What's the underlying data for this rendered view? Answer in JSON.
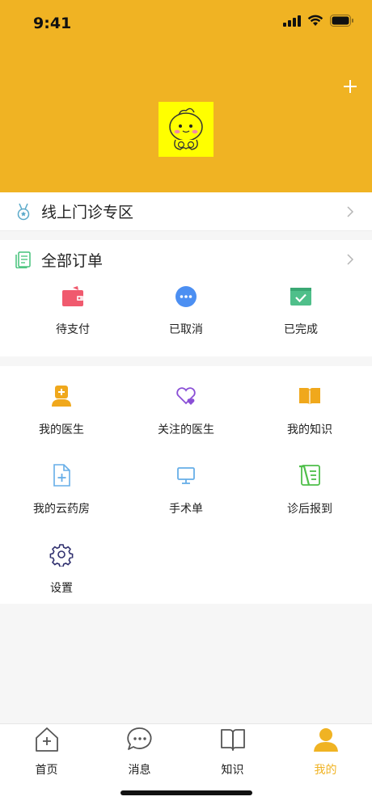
{
  "status_bar": {
    "time": "9:41"
  },
  "clinic_row": {
    "label": "线上门诊专区"
  },
  "orders": {
    "title": "全部订单",
    "items": [
      {
        "label": "待支付",
        "icon": "wallet-icon",
        "color": "#f05a6e"
      },
      {
        "label": "已取消",
        "icon": "more-circle-icon",
        "color": "#4c8ff2"
      },
      {
        "label": "已完成",
        "icon": "inbox-check-icon",
        "color": "#4fbf8a"
      }
    ]
  },
  "tools": {
    "items": [
      {
        "label": "我的医生",
        "icon": "doctor-icon"
      },
      {
        "label": "关注的医生",
        "icon": "heart-follow-icon"
      },
      {
        "label": "我的知识",
        "icon": "book-icon"
      },
      {
        "label": "我的云药房",
        "icon": "file-add-icon"
      },
      {
        "label": "手术单",
        "icon": "monitor-icon"
      },
      {
        "label": "诊后报到",
        "icon": "checklist-icon"
      },
      {
        "label": "设置",
        "icon": "gear-icon"
      }
    ]
  },
  "tabbar": {
    "tabs": [
      {
        "label": "首页",
        "icon": "home-icon"
      },
      {
        "label": "消息",
        "icon": "chat-icon"
      },
      {
        "label": "知识",
        "icon": "open-book-icon"
      },
      {
        "label": "我的",
        "icon": "user-icon",
        "active": true
      }
    ],
    "active_color": "#f0b323"
  },
  "colors": {
    "header": "#f0b323",
    "avatar_bg": "#ffff00"
  }
}
